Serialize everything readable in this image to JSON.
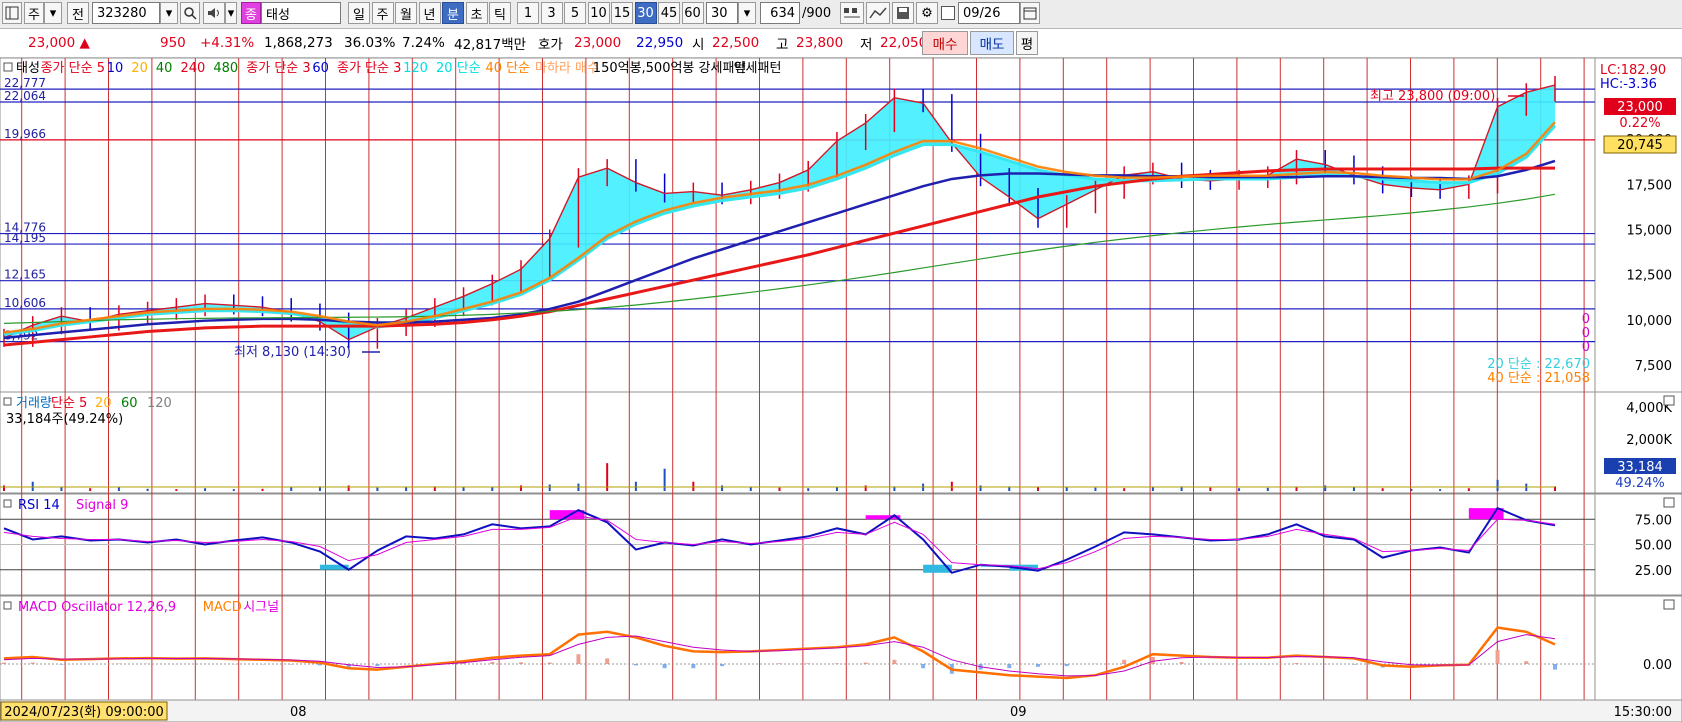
{
  "toolbar": {
    "mode_label": "주",
    "prev_label": "전",
    "code": "323280",
    "badge": "종",
    "stock_name": "태성",
    "period_buttons": [
      "일",
      "주",
      "월",
      "년",
      "분",
      "초",
      "틱"
    ],
    "selected_period": "분",
    "interval_buttons": [
      "1",
      "3",
      "5",
      "10",
      "15",
      "30",
      "45",
      "60"
    ],
    "selected_interval": "30",
    "interval_select": "30",
    "count_value": "634",
    "count_total": "/900",
    "date_value": "09/26"
  },
  "quote": {
    "price": "23,000 ▲",
    "change": "950",
    "change_pct": "+4.31%",
    "volume": "1,868,273",
    "volume_ratio": "36.03%",
    "turnover": "7.24%",
    "amount": "42,817백만",
    "ask_label": "호가",
    "ask": "23,000",
    "bid": "22,950",
    "open_label": "시",
    "open": "22,500",
    "high_label": "고",
    "high": "23,800",
    "low_label": "저",
    "low": "22,050",
    "buy_label": "매수",
    "sell_label": "매도",
    "eval_label": "평"
  },
  "price_panel": {
    "legend": [
      {
        "text": "태성",
        "color": "#000000"
      },
      {
        "text": "종가 단순 5",
        "color": "#e0001b"
      },
      {
        "text": "10",
        "color": "#0000d0"
      },
      {
        "text": "20",
        "color": "#ffb000"
      },
      {
        "text": "40",
        "color": "#008000"
      },
      {
        "text": "240",
        "color": "#e0001b"
      },
      {
        "text": "480",
        "color": "#008000"
      },
      {
        "text": "종가 단순 3",
        "color": "#e0001b"
      },
      {
        "text": "60",
        "color": "#0000d0"
      },
      {
        "text": "종가 단순 3",
        "color": "#e0001b"
      },
      {
        "text": "120",
        "color": "#00e0e0"
      },
      {
        "text": "20 단순",
        "color": "#00e0e0"
      },
      {
        "text": "40 단순",
        "color": "#ff8000"
      },
      {
        "text": "마하라 매수",
        "color": "#ffa060"
      },
      {
        "text": "150억봉,500억봉 강세패턴",
        "color": "#000000"
      },
      {
        "text": "약세패턴",
        "color": "#000000"
      }
    ],
    "left_levels": [
      "22,777",
      "22,064",
      "19,966",
      "14,776",
      "14,195",
      "12,165",
      "10,606",
      "8,792"
    ],
    "axis_ticks": [
      "20,000",
      "17,500",
      "15,000",
      "12,500",
      "10,000",
      "7,500"
    ],
    "lc_label": "LC:182.90",
    "hc_label": "HC:-3.36",
    "price_tag": "23,000",
    "pct_tag": "0.22%",
    "ma_tag": "20,745",
    "high_annotation": "최고 23,800 (09:00)",
    "low_annotation": "최저 8,130 (14:30)",
    "zero_labels": [
      "0",
      "0",
      "0"
    ],
    "ma20_label": "20 단순 : 22,670",
    "ma40_label": "40 단순 : 21,058"
  },
  "volume_panel": {
    "legend": [
      {
        "text": "거래량",
        "color": "#0070c0"
      },
      {
        "text": "단순 5",
        "color": "#e0001b"
      },
      {
        "text": "20",
        "color": "#ffb000"
      },
      {
        "text": "60",
        "color": "#008000"
      },
      {
        "text": "120",
        "color": "#808080"
      }
    ],
    "current": "33,184주(49.24%)",
    "axis_ticks": [
      "4,000K",
      "2,000K"
    ],
    "volume_tag": "33,184",
    "pct_tag": "49.24%"
  },
  "rsi_panel": {
    "legend": [
      {
        "text": "RSI 14",
        "color": "#0000d0"
      },
      {
        "text": "Signal 9",
        "color": "#e000e0"
      }
    ],
    "axis_ticks": [
      "75.00",
      "50.00",
      "25.00"
    ]
  },
  "macd_panel": {
    "legend": [
      {
        "text": "MACD Oscillator 12,26,9",
        "color": "#e000e0"
      },
      {
        "text": "MACD",
        "color": "#ff8000"
      },
      {
        "text": "시그널",
        "color": "#e000e0"
      }
    ],
    "axis_tick": "0.00"
  },
  "time_axis": {
    "cursor_label": "2024/07/23(화) 09:00:00",
    "labels": [
      "08",
      "09"
    ],
    "end_time": "15:30:00"
  },
  "colors": {
    "up": "#e0001b",
    "down": "#0000d0",
    "grid_vertical": "#d03030",
    "accent_blue": "#3d6cc2",
    "ma_cyan": "#33e6f0",
    "ma_orange": "#ff8000",
    "rsi_fill": "#ff00ff"
  },
  "chart_data": [
    {
      "type": "line",
      "title": "",
      "yrange": [
        6000,
        24500
      ],
      "series": [
        {
          "name": "태성",
          "values": [
            9000,
            9700,
            10200,
            9900,
            10300,
            10500,
            10700,
            10900,
            10800,
            10700,
            10400,
            9900,
            8900,
            9600,
            10100,
            10700,
            11300,
            12000,
            12800,
            14500,
            17900,
            18400,
            17600,
            17000,
            17100,
            16900,
            17200,
            17600,
            18300,
            19900,
            20900,
            22300,
            22000,
            19800,
            17900,
            16800,
            15600,
            16400,
            17200,
            18000,
            18200,
            17800,
            17700,
            17800,
            18000,
            18900,
            18600,
            18000,
            17500,
            17300,
            17200,
            17500,
            21800,
            22600,
            23000
          ]
        },
        {
          "name": "20 단순",
          "values": [
            9200,
            9400,
            9700,
            9900,
            10100,
            10300,
            10400,
            10500,
            10500,
            10450,
            10350,
            10100,
            9800,
            9600,
            9800,
            10100,
            10500,
            10900,
            11400,
            12200,
            13300,
            14500,
            15300,
            15900,
            16300,
            16600,
            16800,
            17000,
            17300,
            17800,
            18400,
            19100,
            19700,
            19700,
            19300,
            18800,
            18300,
            18000,
            17800,
            17700,
            17700,
            17750,
            17800,
            17800,
            17800,
            17900,
            18000,
            17950,
            17800,
            17700,
            17600,
            17600,
            18100,
            19000,
            20745
          ]
        },
        {
          "name": "40 단순",
          "values": [
            9000,
            9150,
            9300,
            9450,
            9600,
            9750,
            9850,
            9950,
            10000,
            10050,
            10050,
            10000,
            9900,
            9850,
            9850,
            9900,
            10000,
            10100,
            10300,
            10600,
            11000,
            11600,
            12200,
            12800,
            13400,
            13900,
            14400,
            14900,
            15400,
            15900,
            16400,
            16900,
            17400,
            17800,
            18000,
            18100,
            18100,
            18050,
            18000,
            18000,
            17950,
            17950,
            17900,
            17900,
            17900,
            17900,
            17950,
            17950,
            17900,
            17850,
            17850,
            17800,
            17950,
            18300,
            18800
          ]
        },
        {
          "name": "240",
          "values": [
            8600,
            8750,
            8900,
            9050,
            9200,
            9350,
            9450,
            9550,
            9600,
            9650,
            9650,
            9650,
            9650,
            9650,
            9700,
            9750,
            9850,
            10000,
            10200,
            10450,
            10800,
            11150,
            11500,
            11850,
            12200,
            12550,
            12900,
            13250,
            13600,
            14000,
            14400,
            14800,
            15200,
            15600,
            16000,
            16400,
            16800,
            17100,
            17400,
            17600,
            17800,
            17950,
            18050,
            18150,
            18250,
            18300,
            18350,
            18350,
            18350,
            18350,
            18350,
            18350,
            18400,
            18400,
            18400
          ]
        },
        {
          "name": "480",
          "values": [
            9800,
            9850,
            9900,
            9950,
            10000,
            10030,
            10060,
            10080,
            10100,
            10110,
            10120,
            10130,
            10140,
            10150,
            10170,
            10200,
            10250,
            10300,
            10380,
            10460,
            10560,
            10680,
            10820,
            10980,
            11150,
            11330,
            11520,
            11720,
            11930,
            12150,
            12380,
            12620,
            12870,
            13120,
            13370,
            13620,
            13860,
            14080,
            14290,
            14480,
            14660,
            14830,
            14990,
            15140,
            15280,
            15410,
            15530,
            15650,
            15780,
            15920,
            16080,
            16250,
            16450,
            16680,
            16950
          ]
        }
      ]
    },
    {
      "type": "line",
      "title": "",
      "yrange": [
        0,
        100
      ],
      "series": [
        {
          "name": "RSI 14",
          "values": [
            66,
            55,
            58,
            54,
            55,
            52,
            55,
            50,
            54,
            57,
            52,
            43,
            25,
            44,
            58,
            56,
            60,
            70,
            66,
            68,
            84,
            72,
            45,
            52,
            49,
            55,
            50,
            54,
            58,
            66,
            60,
            79,
            55,
            22,
            30,
            28,
            24,
            35,
            48,
            62,
            60,
            57,
            54,
            55,
            60,
            70,
            58,
            55,
            37,
            44,
            47,
            42,
            86,
            74,
            69
          ]
        },
        {
          "name": "Signal 9",
          "values": [
            62,
            58,
            56,
            55,
            55,
            53,
            54,
            52,
            53,
            55,
            53,
            48,
            34,
            40,
            52,
            55,
            58,
            65,
            65,
            67,
            78,
            74,
            55,
            52,
            50,
            53,
            51,
            53,
            56,
            62,
            60,
            72,
            60,
            32,
            30,
            29,
            26,
            32,
            43,
            56,
            58,
            57,
            55,
            55,
            58,
            65,
            60,
            56,
            43,
            44,
            46,
            44,
            75,
            74,
            70
          ]
        }
      ]
    },
    {
      "type": "line",
      "title": "",
      "series": [
        {
          "name": "MACD",
          "values": [
            0.4,
            0.5,
            0.3,
            0.35,
            0.4,
            0.42,
            0.38,
            0.4,
            0.35,
            0.3,
            0.25,
            0.1,
            -0.3,
            -0.4,
            -0.2,
            0.0,
            0.2,
            0.45,
            0.6,
            0.7,
            2.1,
            2.3,
            1.9,
            1.3,
            0.9,
            0.85,
            0.9,
            1.0,
            1.1,
            1.2,
            1.4,
            1.9,
            0.9,
            -0.4,
            -0.6,
            -0.8,
            -0.9,
            -1.0,
            -0.8,
            -0.2,
            0.7,
            0.6,
            0.5,
            0.45,
            0.45,
            0.6,
            0.5,
            0.4,
            -0.1,
            -0.2,
            -0.1,
            -0.05,
            2.6,
            2.3,
            1.4
          ]
        },
        {
          "name": "시그널",
          "values": [
            0.3,
            0.4,
            0.35,
            0.35,
            0.37,
            0.4,
            0.39,
            0.39,
            0.37,
            0.33,
            0.29,
            0.2,
            -0.05,
            -0.25,
            -0.2,
            -0.05,
            0.1,
            0.3,
            0.48,
            0.6,
            1.4,
            1.9,
            2.0,
            1.6,
            1.2,
            1.0,
            0.9,
            0.95,
            1.05,
            1.15,
            1.3,
            1.6,
            1.2,
            0.3,
            -0.2,
            -0.5,
            -0.7,
            -0.85,
            -0.82,
            -0.5,
            0.2,
            0.45,
            0.5,
            0.47,
            0.46,
            0.53,
            0.52,
            0.45,
            0.15,
            -0.05,
            -0.08,
            -0.06,
            1.6,
            2.1,
            1.8
          ]
        }
      ]
    }
  ]
}
